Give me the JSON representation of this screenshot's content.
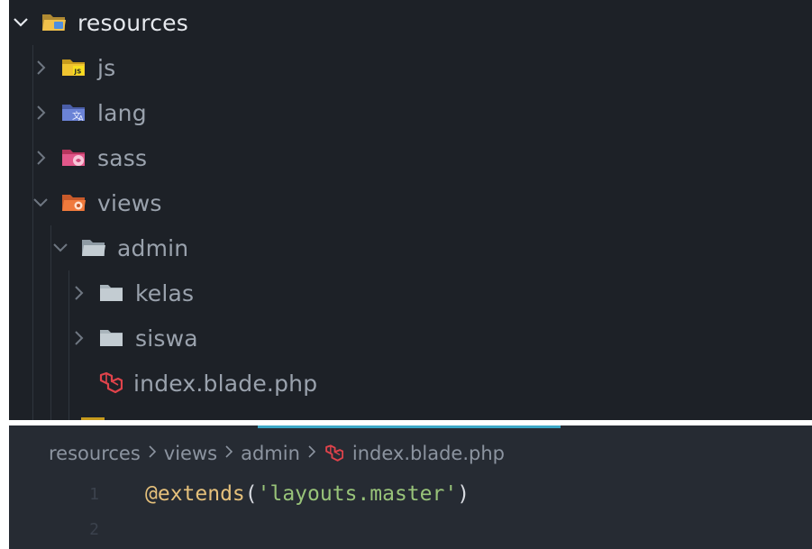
{
  "explorer": {
    "items": [
      {
        "label": "resources",
        "expanded": true,
        "icon": "resources-folder-open-icon",
        "level": 0
      },
      {
        "label": "js",
        "expanded": false,
        "icon": "js-folder-icon",
        "level": 1
      },
      {
        "label": "lang",
        "expanded": false,
        "icon": "lang-folder-icon",
        "level": 1
      },
      {
        "label": "sass",
        "expanded": false,
        "icon": "sass-folder-icon",
        "level": 1
      },
      {
        "label": "views",
        "expanded": true,
        "icon": "views-folder-open-icon",
        "level": 1
      },
      {
        "label": "admin",
        "expanded": true,
        "icon": "folder-open-icon",
        "level": 2
      },
      {
        "label": "kelas",
        "expanded": false,
        "icon": "folder-icon",
        "level": 3
      },
      {
        "label": "siswa",
        "expanded": false,
        "icon": "folder-icon",
        "level": 3
      },
      {
        "label": "index.blade.php",
        "icon": "laravel-blade-icon",
        "level": 3
      }
    ]
  },
  "editor": {
    "breadcrumb": [
      "resources",
      "views",
      "admin",
      "index.blade.php"
    ],
    "lines": [
      {
        "number": "1",
        "directive": "@extends",
        "open": "(",
        "string": "'layouts.master'",
        "close": ")"
      },
      {
        "number": "2",
        "directive": "",
        "open": "",
        "string": "",
        "close": ""
      }
    ]
  },
  "colors": {
    "explorer_bg": "#1d2127",
    "editor_bg": "#262b33",
    "accent": "#3ca7c6",
    "blade_red": "#e0434b"
  }
}
